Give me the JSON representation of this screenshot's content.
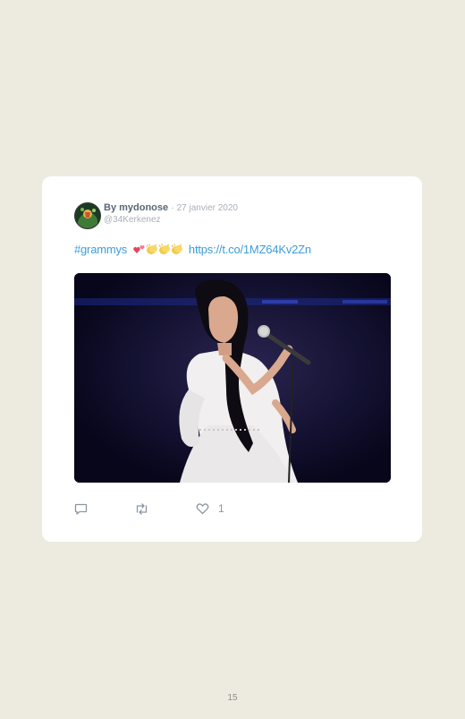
{
  "tweet": {
    "author_prefix": "By",
    "author_name": "mydonose",
    "separator": "·",
    "date": "27 janvier 2020",
    "handle": "@34Kerkenez",
    "hashtag": "#grammys",
    "link": "https://t.co/1MZ64Kv2Zn",
    "emojis": [
      "two-hearts-emoji",
      "clapping-hands-emoji",
      "clapping-hands-emoji",
      "clapping-hands-emoji"
    ],
    "photo_subject": "performer-singing-at-microphone",
    "actions": {
      "reply_icon": "reply-icon",
      "retweet_icon": "retweet-icon",
      "like_icon": "heart-icon",
      "like_count": "1"
    }
  },
  "page": {
    "number": "15"
  },
  "colors": {
    "background": "#edeae0",
    "card": "#ffffff",
    "link": "#3e9ddb",
    "muted": "#a9b0b9",
    "author": "#5a6778"
  }
}
